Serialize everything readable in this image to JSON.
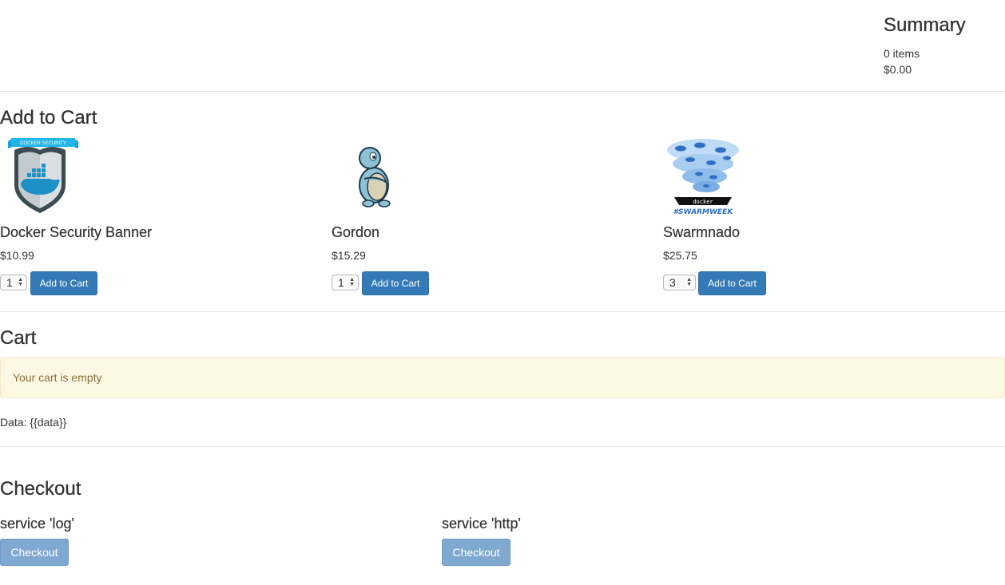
{
  "summary": {
    "title": "Summary",
    "items": "0 items",
    "total": "$0.00"
  },
  "add_to_cart": {
    "heading": "Add to Cart",
    "products": [
      {
        "name": "Docker Security Banner",
        "price": "$10.99",
        "qty": "1",
        "button": "Add to Cart",
        "icon": "docker-security-shield-icon",
        "banner_text": "DOCKER SECURITY"
      },
      {
        "name": "Gordon",
        "price": "$15.29",
        "qty": "1",
        "button": "Add to Cart",
        "icon": "gordon-turtle-icon"
      },
      {
        "name": "Swarmnado",
        "price": "$25.75",
        "qty": "3",
        "button": "Add to Cart",
        "icon": "swarmnado-icon",
        "logo_text": "docker",
        "hashtag": "#SWARMWEEK"
      }
    ]
  },
  "cart": {
    "heading": "Cart",
    "empty_message": "Your cart is empty",
    "data_text": "Data: {{data}}"
  },
  "checkout": {
    "heading": "Checkout",
    "services": [
      {
        "title": "service 'log'",
        "button": "Checkout"
      },
      {
        "title": "service 'http'",
        "button": "Checkout"
      }
    ]
  },
  "colors": {
    "primary": "#337ab7",
    "disabled": "#80a9d1",
    "alert_bg": "#fcf8e3",
    "alert_text": "#8a6d3b"
  }
}
